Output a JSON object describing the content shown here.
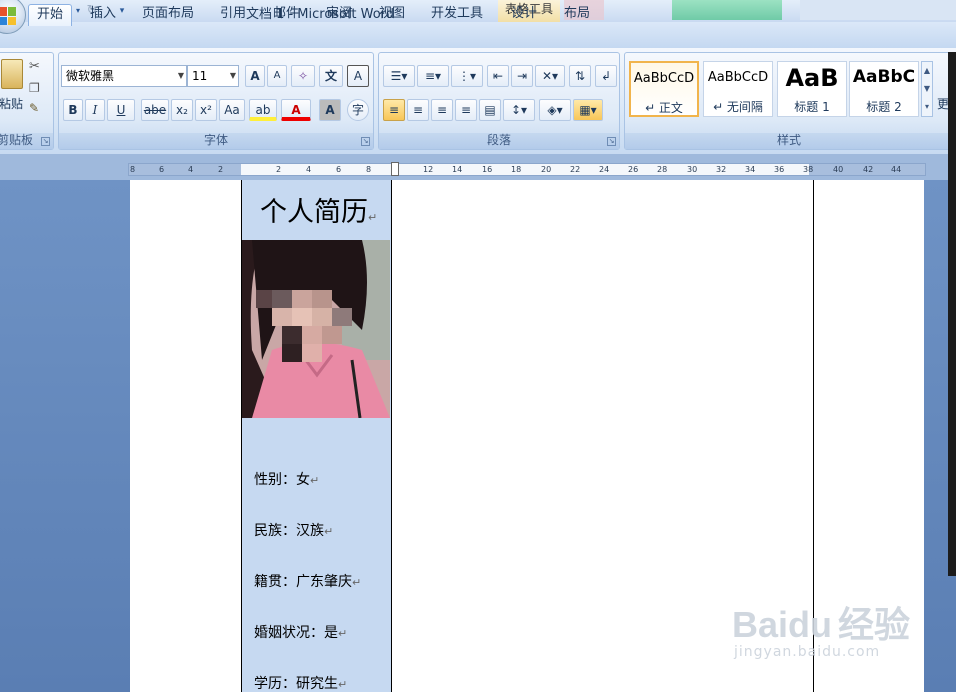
{
  "window": {
    "title": "文档 1 - Microsoft Word",
    "context_tab": "表格工具"
  },
  "tabs": [
    {
      "label": "开始",
      "active": true
    },
    {
      "label": "插入"
    },
    {
      "label": "页面布局"
    },
    {
      "label": "引用"
    },
    {
      "label": "邮件"
    },
    {
      "label": "审阅"
    },
    {
      "label": "视图"
    },
    {
      "label": "开发工具"
    },
    {
      "label": "设计"
    },
    {
      "label": "布局"
    }
  ],
  "ribbon": {
    "clipboard": {
      "label": "剪贴板",
      "paste_label": "粘贴"
    },
    "font": {
      "label": "字体",
      "font_name": "微软雅黑",
      "font_size": "11",
      "grow": "A",
      "shrink": "A",
      "bold": "B",
      "italic": "I",
      "underline": "U",
      "strike": "abe",
      "subscript": "x₂",
      "superscript": "x²",
      "case": "Aa",
      "highlight": "ab",
      "font_color": "A",
      "char_shading": "A",
      "wen": "文",
      "zi": "字"
    },
    "paragraph": {
      "label": "段落"
    },
    "styles": {
      "label": "样式",
      "items": [
        {
          "preview": "AaBbCcD",
          "name": "↵ 正文"
        },
        {
          "preview": "AaBbCcD",
          "name": "↵ 无间隔"
        },
        {
          "preview": "AaB",
          "name": "标题 1"
        },
        {
          "preview": "AaBbC",
          "name": "标题 2"
        }
      ],
      "more": "更"
    }
  },
  "ruler": {
    "ticks": [
      "8",
      "6",
      "4",
      "2",
      "2",
      "4",
      "6",
      "8",
      "12",
      "14",
      "16",
      "18",
      "20",
      "22",
      "24",
      "26",
      "28",
      "30",
      "32",
      "34",
      "36",
      "38",
      "40",
      "42",
      "44"
    ]
  },
  "document": {
    "title": "个人简历",
    "paragraph_mark": "↵",
    "fields": [
      "性别：女",
      "民族：汉族",
      "籍贯：广东肇庆",
      "婚姻状况：是",
      "学历：研究生"
    ]
  },
  "watermark": {
    "brand": "Baidu",
    "cn": "经验",
    "url": "jingyan.baidu.com"
  },
  "colors": {
    "ribbon": "#dbe8f8",
    "cell_fill": "#c6d9f1",
    "accent": "#f1b44c"
  }
}
